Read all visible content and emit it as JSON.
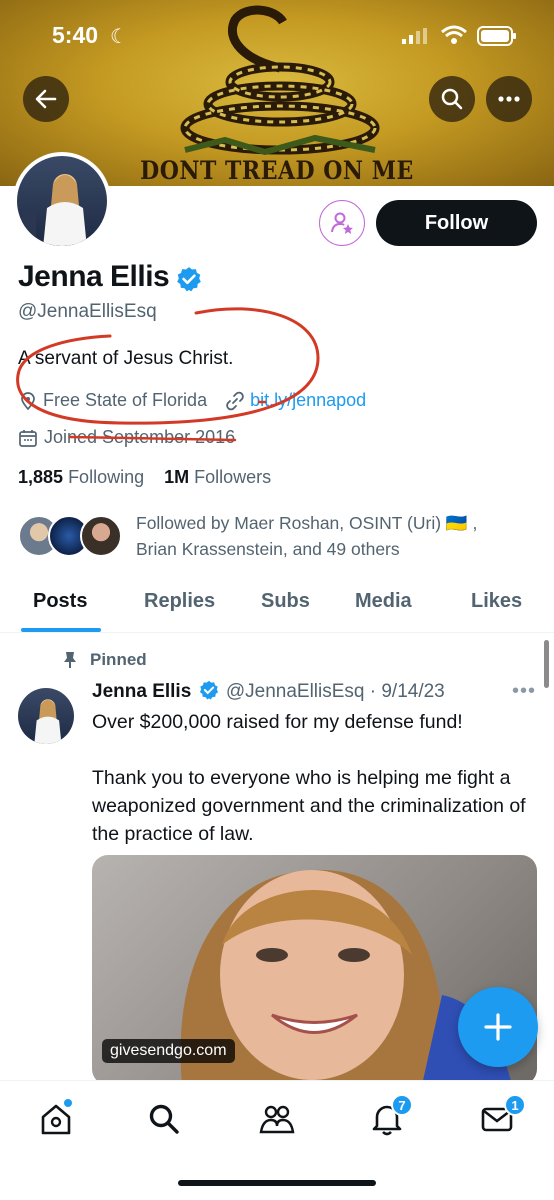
{
  "status_bar": {
    "time": "5:40"
  },
  "banner": {
    "text": "DONT TREAD ON ME"
  },
  "profile": {
    "name": "Jenna Ellis",
    "handle": "@JennaEllisEsq",
    "bio": "A servant of Jesus Christ.",
    "location": "Free State of Florida",
    "link": "bit.ly/jennapod",
    "joined": "Joined September 2016",
    "following_count": "1,885",
    "following_label": "Following",
    "followers_count": "1M",
    "followers_label": "Followers",
    "follow_button": "Follow",
    "followed_by_line1": "Followed by Maer Roshan, OSINT (Uri) 🇺🇦 ,",
    "followed_by_line2": "Brian Krassenstein, and 49 others"
  },
  "tabs": [
    "Posts",
    "Replies",
    "Subs",
    "Media",
    "Likes"
  ],
  "post": {
    "pinned_label": "Pinned",
    "author": "Jenna Ellis",
    "handle_date": "@JennaEllisEsq · 9/14/23",
    "text": "Over $200,000 raised for my defense fund!\n\nThank you to everyone who is helping me fight a weaponized government and the criminalization of the practice of law.",
    "image_chip": "givesendgo.com"
  },
  "nav": {
    "notifications_badge": "7",
    "messages_badge": "1"
  },
  "colors": {
    "accent": "#1d9bf0",
    "annotation": "#d23a26",
    "subscribe": "#c06ad9"
  }
}
